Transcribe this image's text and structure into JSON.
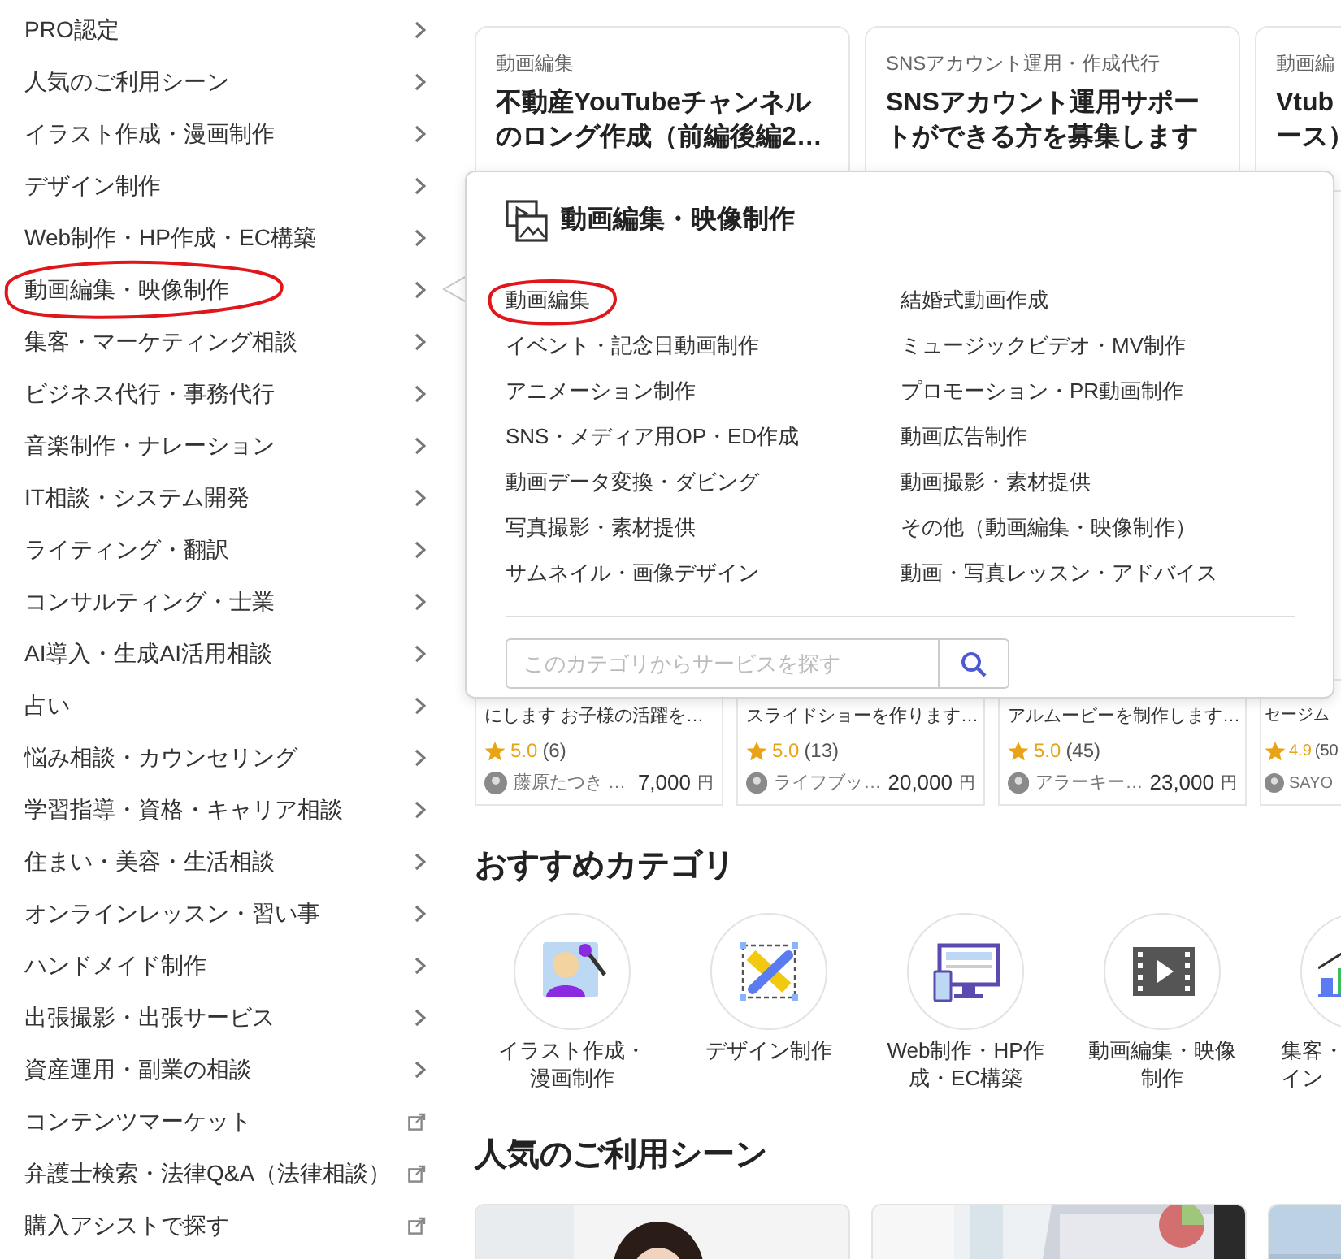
{
  "sidebar": {
    "items": [
      {
        "label": "PRO認定",
        "kind": "chevron",
        "selected": false,
        "circled": false
      },
      {
        "label": "人気のご利用シーン",
        "kind": "chevron",
        "selected": false,
        "circled": false
      },
      {
        "label": "イラスト作成・漫画制作",
        "kind": "chevron",
        "selected": false,
        "circled": false
      },
      {
        "label": "デザイン制作",
        "kind": "chevron",
        "selected": false,
        "circled": false
      },
      {
        "label": "Web制作・HP作成・EC構築",
        "kind": "chevron",
        "selected": false,
        "circled": false
      },
      {
        "label": "動画編集・映像制作",
        "kind": "chevron",
        "selected": true,
        "circled": true
      },
      {
        "label": "集客・マーケティング相談",
        "kind": "chevron",
        "selected": false,
        "circled": false
      },
      {
        "label": "ビジネス代行・事務代行",
        "kind": "chevron",
        "selected": false,
        "circled": false
      },
      {
        "label": "音楽制作・ナレーション",
        "kind": "chevron",
        "selected": false,
        "circled": false
      },
      {
        "label": "IT相談・システム開発",
        "kind": "chevron",
        "selected": false,
        "circled": false
      },
      {
        "label": "ライティング・翻訳",
        "kind": "chevron",
        "selected": false,
        "circled": false
      },
      {
        "label": "コンサルティング・士業",
        "kind": "chevron",
        "selected": false,
        "circled": false
      },
      {
        "label": "AI導入・生成AI活用相談",
        "kind": "chevron",
        "selected": false,
        "circled": false
      },
      {
        "label": "占い",
        "kind": "chevron",
        "selected": false,
        "circled": false
      },
      {
        "label": "悩み相談・カウンセリング",
        "kind": "chevron",
        "selected": false,
        "circled": false
      },
      {
        "label": "学習指導・資格・キャリア相談",
        "kind": "chevron",
        "selected": false,
        "circled": false
      },
      {
        "label": "住まい・美容・生活相談",
        "kind": "chevron",
        "selected": false,
        "circled": false
      },
      {
        "label": "オンラインレッスン・習い事",
        "kind": "chevron",
        "selected": false,
        "circled": false
      },
      {
        "label": "ハンドメイド制作",
        "kind": "chevron",
        "selected": false,
        "circled": false
      },
      {
        "label": "出張撮影・出張サービス",
        "kind": "chevron",
        "selected": false,
        "circled": false
      },
      {
        "label": "資産運用・副業の相談",
        "kind": "chevron",
        "selected": false,
        "circled": false
      },
      {
        "label": "コンテンツマーケット",
        "kind": "external",
        "selected": false,
        "circled": false
      },
      {
        "label": "弁護士検索・法律Q&A（法律相談）",
        "kind": "external",
        "selected": false,
        "circled": false
      },
      {
        "label": "購入アシストで探す",
        "kind": "external",
        "selected": false,
        "circled": false
      }
    ]
  },
  "featured_services": [
    {
      "category": "動画編集",
      "title_lines": [
        "不動産YouTubeチャンネル",
        "のロング作成（前編後編2…"
      ]
    },
    {
      "category": "SNSアカウント運用・作成代行",
      "title_lines": [
        "SNSアカウント運用サポー",
        "トができる方を募集します"
      ]
    },
    {
      "category": "動画編",
      "title_lines": [
        "Vtub",
        "ース）"
      ]
    }
  ],
  "popover": {
    "title": "動画編集・映像制作",
    "items": [
      {
        "label": "動画編集",
        "circled": true
      },
      {
        "label": "結婚式動画作成",
        "circled": false
      },
      {
        "label": "イベント・記念日動画制作",
        "circled": false
      },
      {
        "label": "ミュージックビデオ・MV制作",
        "circled": false
      },
      {
        "label": "アニメーション制作",
        "circled": false
      },
      {
        "label": "プロモーション・PR動画制作",
        "circled": false
      },
      {
        "label": "SNS・メディア用OP・ED作成",
        "circled": false
      },
      {
        "label": "動画広告制作",
        "circled": false
      },
      {
        "label": "動画データ変換・ダビング",
        "circled": false
      },
      {
        "label": "動画撮影・素材提供",
        "circled": false
      },
      {
        "label": "写真撮影・素材提供",
        "circled": false
      },
      {
        "label": "その他（動画編集・映像制作）",
        "circled": false
      },
      {
        "label": "サムネイル・画像デザイン",
        "circled": false
      },
      {
        "label": "動画・写真レッスン・アドバイス",
        "circled": false
      }
    ],
    "search": {
      "placeholder": "このカテゴリからサービスを探す"
    }
  },
  "services": [
    {
      "title": "にします お子様の活躍を…",
      "rating": "5.0",
      "reviews": "(6)",
      "seller": "藤原たつき …",
      "price": "7,000",
      "currency": "円"
    },
    {
      "title": "スライドショーを作ります…",
      "rating": "5.0",
      "reviews": "(13)",
      "seller": "ライフブッ…",
      "price": "20,000",
      "currency": "円"
    },
    {
      "title": "アルムービーを制作します…",
      "rating": "5.0",
      "reviews": "(45)",
      "seller": "アラーキー…",
      "price": "23,000",
      "currency": "円"
    },
    {
      "title": "セージム",
      "rating": "4.9",
      "reviews": "(50",
      "seller": "SAYO"
    }
  ],
  "recommended": {
    "heading": "おすすめカテゴリ",
    "categories": [
      {
        "kind": "illustration",
        "label_lines": [
          "イラスト作成・",
          "漫画制作"
        ]
      },
      {
        "kind": "design",
        "label_lines": [
          "デザイン制作"
        ]
      },
      {
        "kind": "web",
        "label_lines": [
          "Web制作・HP作",
          "成・EC構築"
        ]
      },
      {
        "kind": "video",
        "label_lines": [
          "動画編集・映像",
          "制作"
        ]
      },
      {
        "kind": "marketing",
        "label_lines": [
          "集客・",
          "イン"
        ]
      }
    ]
  },
  "scenes": {
    "heading": "人気のご利用シーン"
  }
}
